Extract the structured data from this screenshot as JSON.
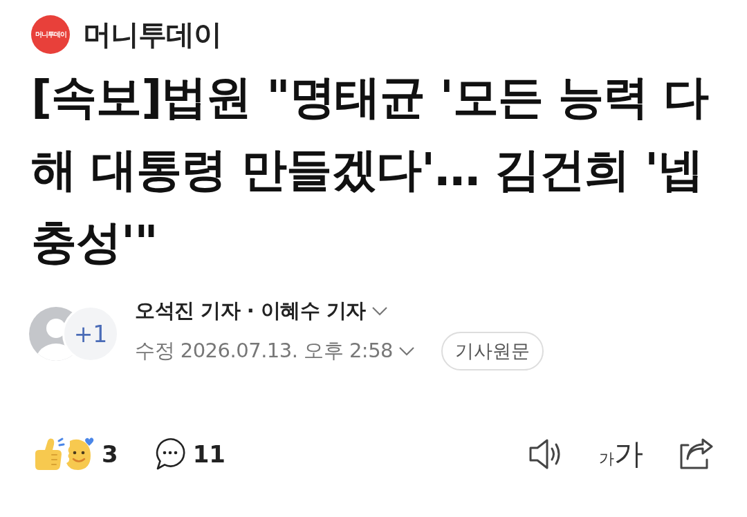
{
  "header": {
    "logo_text": "머니투데이",
    "brand": "머니투데이"
  },
  "headline": "[속보]법원 \"명태균 '모든 능력 다 해 대통령 만들겠다'… 김건희 '넵 충성'\"",
  "byline": {
    "extra_authors": "+1",
    "authors": "오석진 기자 · 이혜수 기자",
    "timestamp": "수정 2026.07.13. 오후 2:58",
    "original_button": "기사원문"
  },
  "actions": {
    "reactions": "3",
    "comments": "11",
    "font_size_small": "가",
    "font_size_large": "가"
  }
}
